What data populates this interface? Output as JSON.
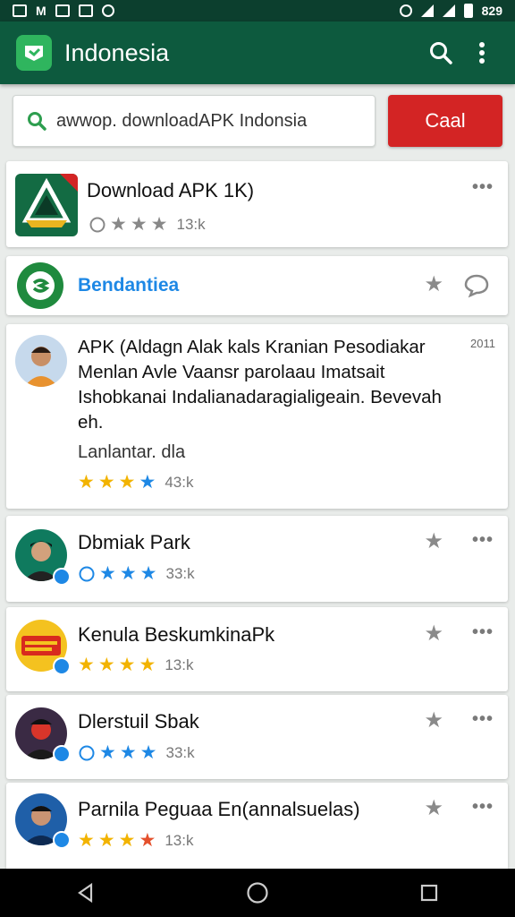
{
  "statusbar": {
    "time": "829"
  },
  "appbar": {
    "title": "Indonesia",
    "brand_color": "#0d5a3e",
    "accent": "#2fb55e"
  },
  "search": {
    "value": "awwop. downloadAPK Indonsia",
    "button": "Caal"
  },
  "header_app": {
    "title": "Download APK 1K)",
    "count": "13:k"
  },
  "featured": {
    "label": "Bendantiea",
    "label_color": "#1e88e5"
  },
  "post": {
    "lines": [
      "APK (Aldagn Alak kals Kranian Pesodiakar",
      "Menlan Avle Vaansr parolaau Imatsait",
      "Ishobkanai Indalianadaragialigeain. Bevevah",
      "eh."
    ],
    "time": "2011",
    "subtitle": "Lanlantar. dla",
    "count": "43:k"
  },
  "items": [
    {
      "title": "Dbmiak Park",
      "count": "33:k"
    },
    {
      "title": "Kenula BeskumkinaPk",
      "count": "13:k"
    },
    {
      "title": "Dlerstuil Sbak",
      "count": "33:k"
    },
    {
      "title": "Parnila Peguaa En(annalsuelas)",
      "count": "13:k"
    }
  ]
}
